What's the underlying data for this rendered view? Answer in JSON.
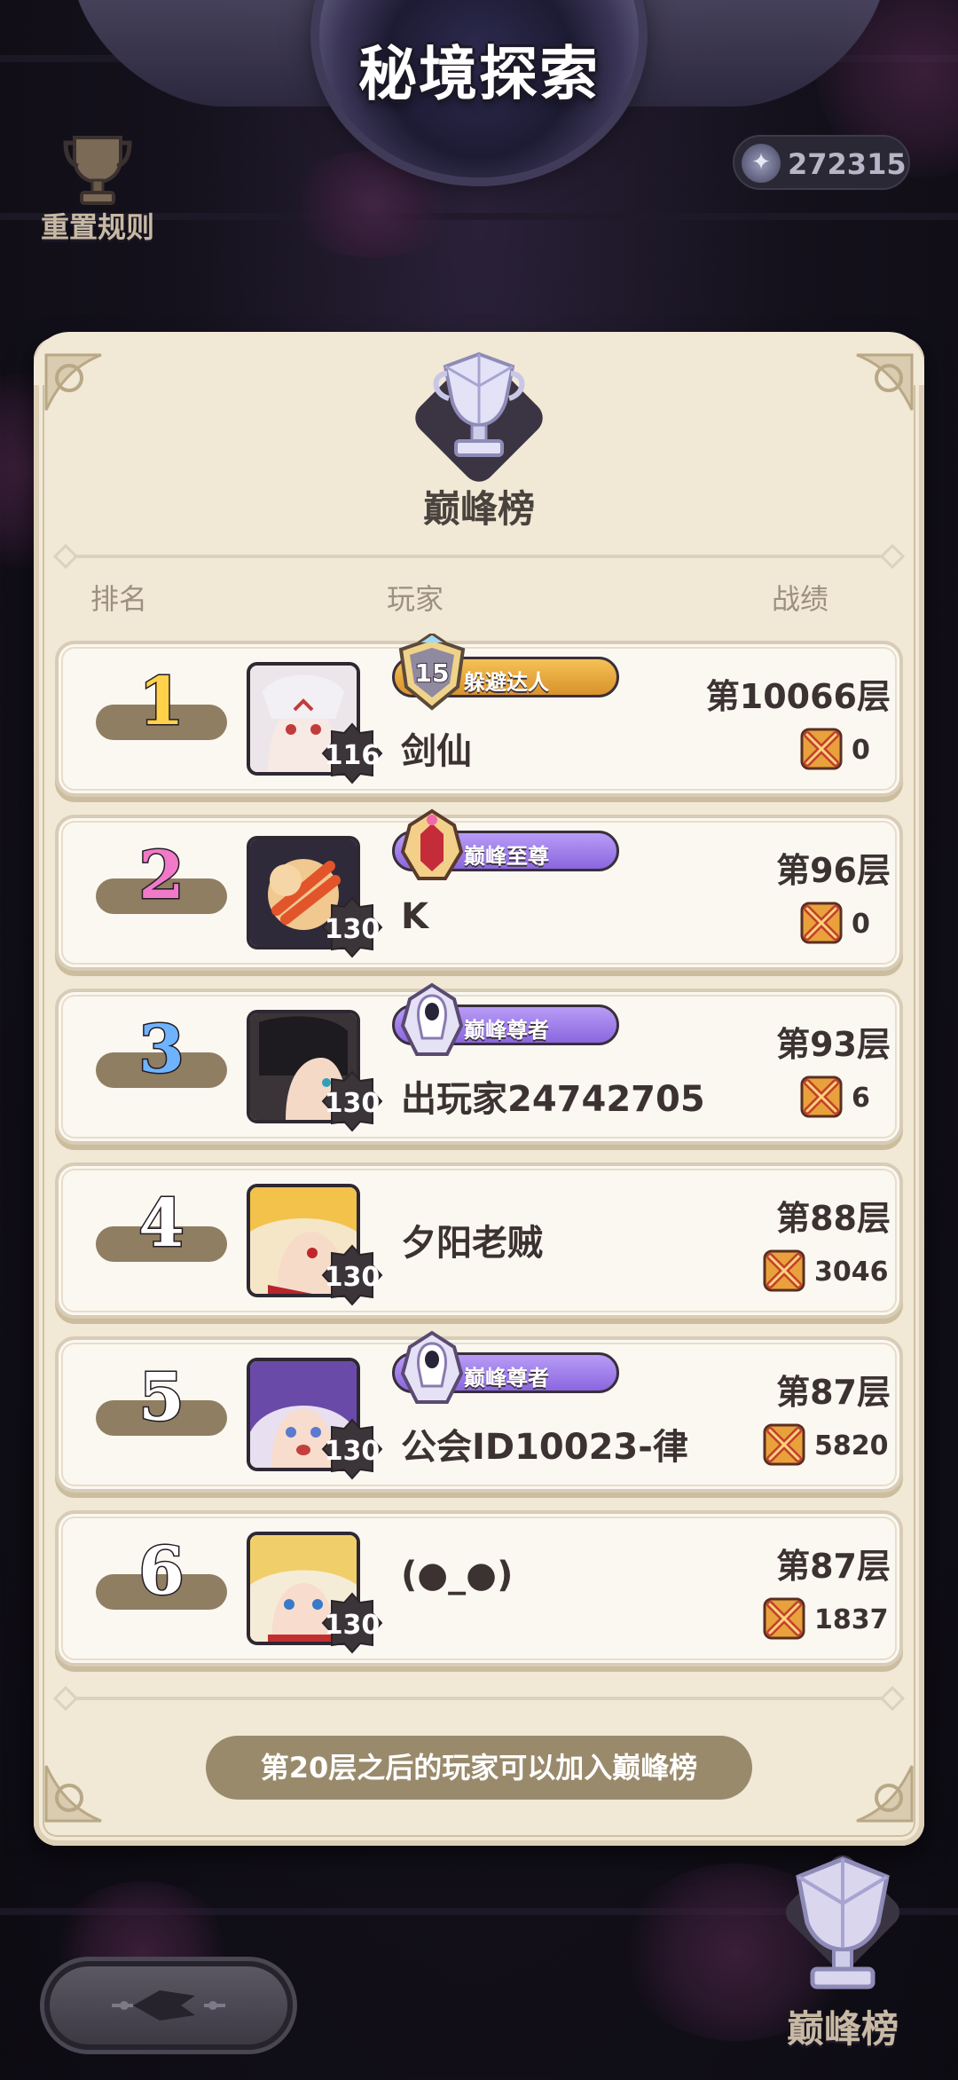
{
  "header": {
    "title": "秘境探索",
    "rules_label": "重置规则",
    "currency_value": "272315"
  },
  "panel": {
    "title": "巅峰榜",
    "columns": {
      "rank": "排名",
      "player": "玩家",
      "record": "战绩"
    },
    "footer_note": "第20层之后的玩家可以加入巅峰榜"
  },
  "rows": [
    {
      "rank": "1",
      "level": "116",
      "badge_label": "躲避达人",
      "badge_number": "15",
      "name": "剑仙",
      "floor": "第10066层",
      "battle": "0"
    },
    {
      "rank": "2",
      "level": "130",
      "badge_label": "巅峰至尊",
      "name": "K",
      "floor": "第96层",
      "battle": "0"
    },
    {
      "rank": "3",
      "level": "130",
      "badge_label": "巅峰尊者",
      "name": "出玩家24742705",
      "floor": "第93层",
      "battle": "6"
    },
    {
      "rank": "4",
      "level": "130",
      "name": "夕阳老贼",
      "floor": "第88层",
      "battle": "3046"
    },
    {
      "rank": "5",
      "level": "130",
      "badge_label": "巅峰尊者",
      "name": "公会ID10023-律",
      "floor": "第87层",
      "battle": "5820"
    },
    {
      "rank": "6",
      "level": "130",
      "name": "(●_●)",
      "floor": "第87层",
      "battle": "1837"
    }
  ],
  "bottom": {
    "peak_label": "巅峰榜"
  },
  "icons": {
    "rules": "trophy-icon",
    "currency": "coin-icon",
    "battle": "crossed-swords-icon",
    "back": "back-arrow-icon"
  },
  "colors": {
    "panel_bg": "#f1e8d6",
    "rank1": "#ffd24a",
    "rank2": "#f07ac9",
    "rank3": "#6eb3ff",
    "badge_gold": "#f4c255",
    "badge_purple": "#b89cf6"
  }
}
